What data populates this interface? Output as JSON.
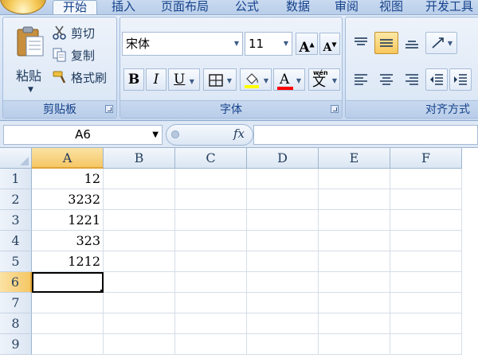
{
  "ribbon": {
    "tabs": [
      {
        "label": "开始",
        "active": true
      },
      {
        "label": "插入",
        "active": false
      },
      {
        "label": "页面布局",
        "active": false
      },
      {
        "label": "公式",
        "active": false
      },
      {
        "label": "数据",
        "active": false
      },
      {
        "label": "审阅",
        "active": false
      },
      {
        "label": "视图",
        "active": false
      },
      {
        "label": "开发工具",
        "active": false
      }
    ],
    "clipboard": {
      "group_label": "剪贴板",
      "paste_label": "粘贴",
      "cut_label": "剪切",
      "copy_label": "复制",
      "format_painter_label": "格式刷"
    },
    "font": {
      "group_label": "字体",
      "font_name": "宋体",
      "font_size": "11",
      "bold_label": "B",
      "italic_label": "I",
      "underline_label": "U",
      "font_color_label": "A",
      "phonetic_top": "wén",
      "phonetic_main": "文",
      "fill_color": "#ffff00",
      "font_color": "#ff0000"
    },
    "alignment": {
      "group_label": "对齐方式"
    }
  },
  "formula_bar": {
    "name_box": "A6",
    "fx_label": "fx",
    "formula": ""
  },
  "sheet": {
    "columns": [
      "A",
      "B",
      "C",
      "D",
      "E",
      "F"
    ],
    "rows": [
      "1",
      "2",
      "3",
      "4",
      "5",
      "6",
      "7",
      "8",
      "9"
    ],
    "selected_cell": "A6",
    "cells": {
      "A1": "12",
      "A2": "3232",
      "A3": "1221",
      "A4": "323",
      "A5": "1212"
    }
  }
}
